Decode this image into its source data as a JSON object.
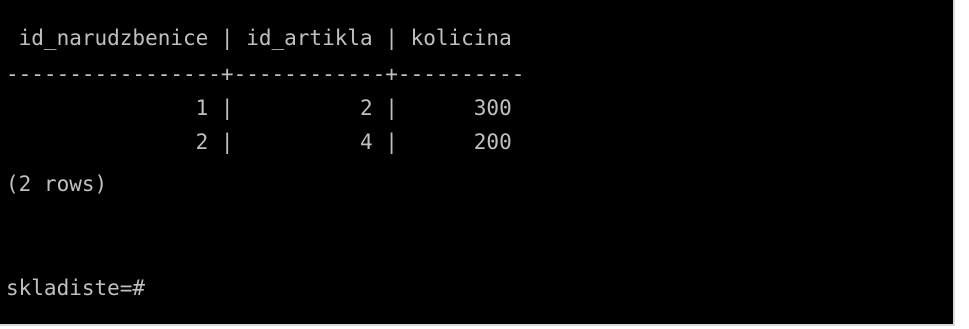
{
  "terminal": {
    "header": " id_narudzbenice | id_artikla | kolicina",
    "separator": "-----------------+------------+----------",
    "rows": [
      "               1 |          2 |      300",
      "               2 |          4 |      200"
    ],
    "row_count": "(2 rows)",
    "prompt": "skladiste=#"
  },
  "colors": {
    "background": "#000000",
    "text": "#c0c0c0"
  }
}
